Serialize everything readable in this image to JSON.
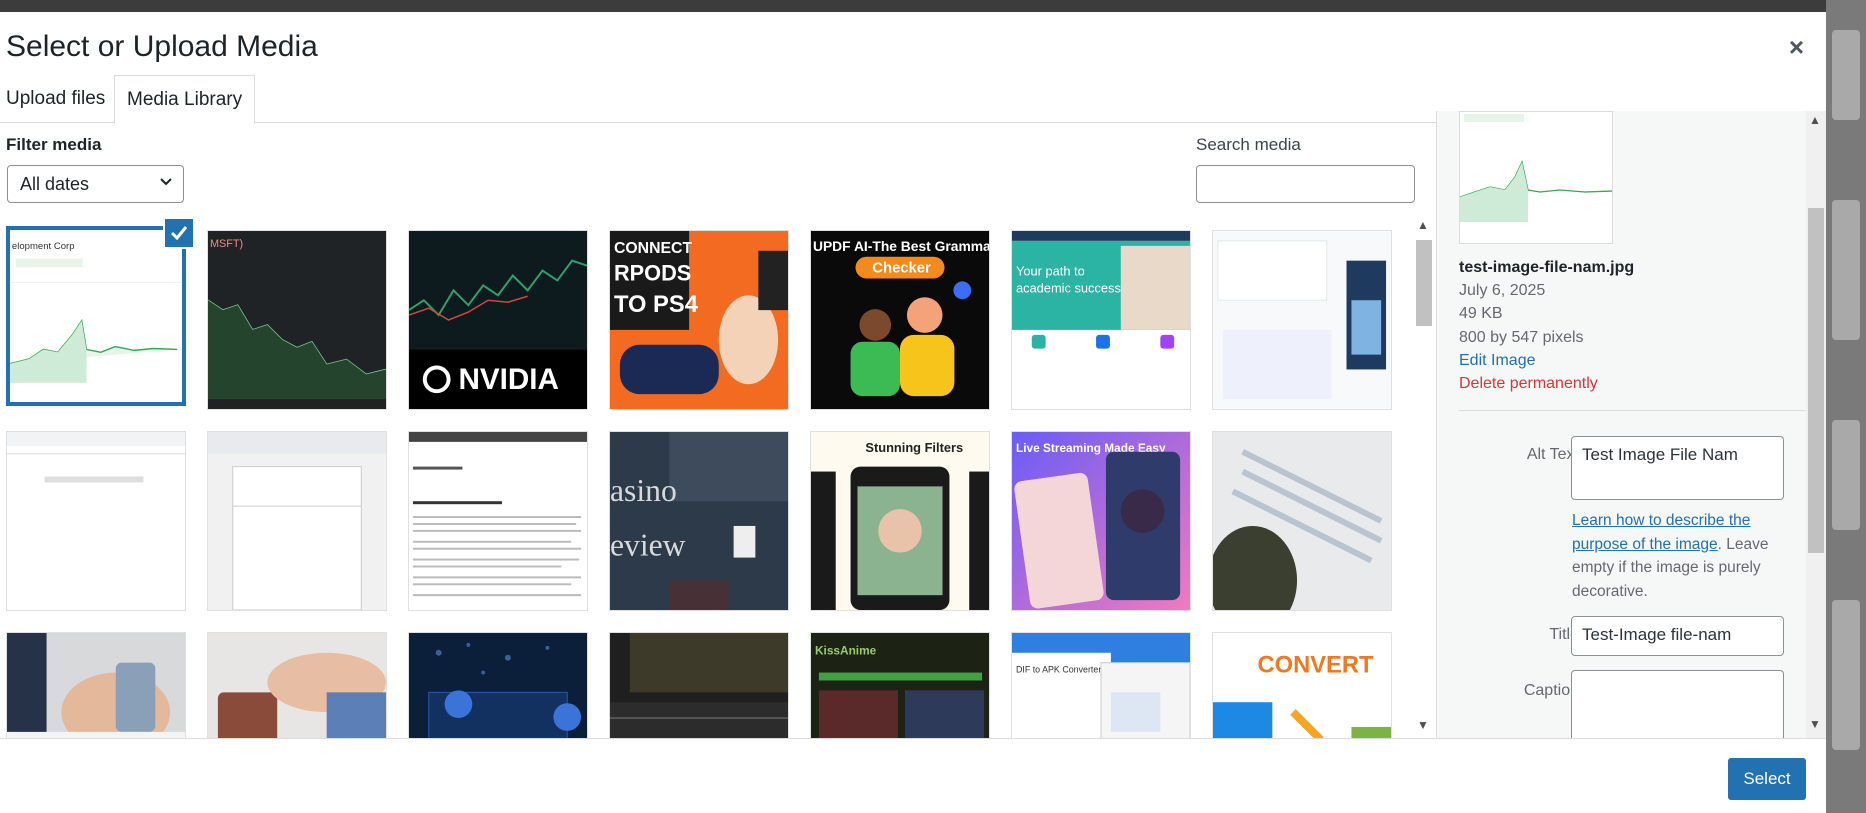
{
  "modal": {
    "title": "Select or Upload Media",
    "close_label": "×"
  },
  "tabs": [
    {
      "label": "Upload files",
      "active": false
    },
    {
      "label": "Media Library",
      "active": true
    }
  ],
  "filter": {
    "label": "Filter media",
    "selected": "All dates"
  },
  "search": {
    "label": "Search media",
    "value": "",
    "placeholder": ""
  },
  "thumbnails": [
    {
      "id": "stock-chart-light",
      "selected": true,
      "text": "elopment Corp"
    },
    {
      "id": "msft-chart-dark",
      "selected": false,
      "text": "MSFT)"
    },
    {
      "id": "nvidia",
      "selected": false,
      "text": "NVIDIA"
    },
    {
      "id": "connect-airpods-ps4",
      "selected": false,
      "text": "CONNECT PODS TO PS4"
    },
    {
      "id": "updf-grammar-checker",
      "selected": false,
      "text": "UPDF AI-The Best Grammar",
      "sub": "Checker"
    },
    {
      "id": "academic-success",
      "selected": false,
      "text": "Your path to academic success"
    },
    {
      "id": "scribe-web-page",
      "selected": false
    },
    {
      "id": "doc-toolbar-1",
      "selected": false
    },
    {
      "id": "doc-toolbar-2",
      "selected": false
    },
    {
      "id": "contract-document",
      "selected": false
    },
    {
      "id": "casino-review",
      "selected": false,
      "text": "asino",
      "sub": "eview"
    },
    {
      "id": "stunning-filters",
      "selected": false,
      "text": "Stunning Filters"
    },
    {
      "id": "live-streaming",
      "selected": false,
      "text": "Live Streaming Made Easy"
    },
    {
      "id": "person-phone",
      "selected": false
    },
    {
      "id": "hands-phone",
      "selected": false
    },
    {
      "id": "hand-wallet",
      "selected": false
    },
    {
      "id": "lock-security",
      "selected": false
    },
    {
      "id": "forum-site",
      "selected": false
    },
    {
      "id": "kissanime",
      "selected": false,
      "text": "KissAnime"
    },
    {
      "id": "apk-converter",
      "selected": false,
      "text": "DIF to APK Converter Tool"
    },
    {
      "id": "convert-android",
      "selected": false,
      "text": "CONVERT"
    }
  ],
  "details": {
    "file_name": "test-image-file-nam.jpg",
    "date": "July 6, 2025",
    "size": "49 KB",
    "dimensions": "800 by 547 pixels",
    "edit_label": "Edit Image",
    "delete_label": "Delete permanently",
    "alt_text": {
      "label": "Alt Text",
      "value": "Test Image File Nam"
    },
    "help": {
      "link": "Learn how to describe the purpose of the image",
      "rest": ". Leave empty if the image is purely decorative."
    },
    "title": {
      "label": "Title",
      "value": "Test-Image file-nam"
    },
    "caption": {
      "label": "Caption",
      "value": ""
    }
  },
  "footer": {
    "select_label": "Select"
  },
  "colors": {
    "accent": "#2271b1",
    "danger": "#d63638"
  }
}
